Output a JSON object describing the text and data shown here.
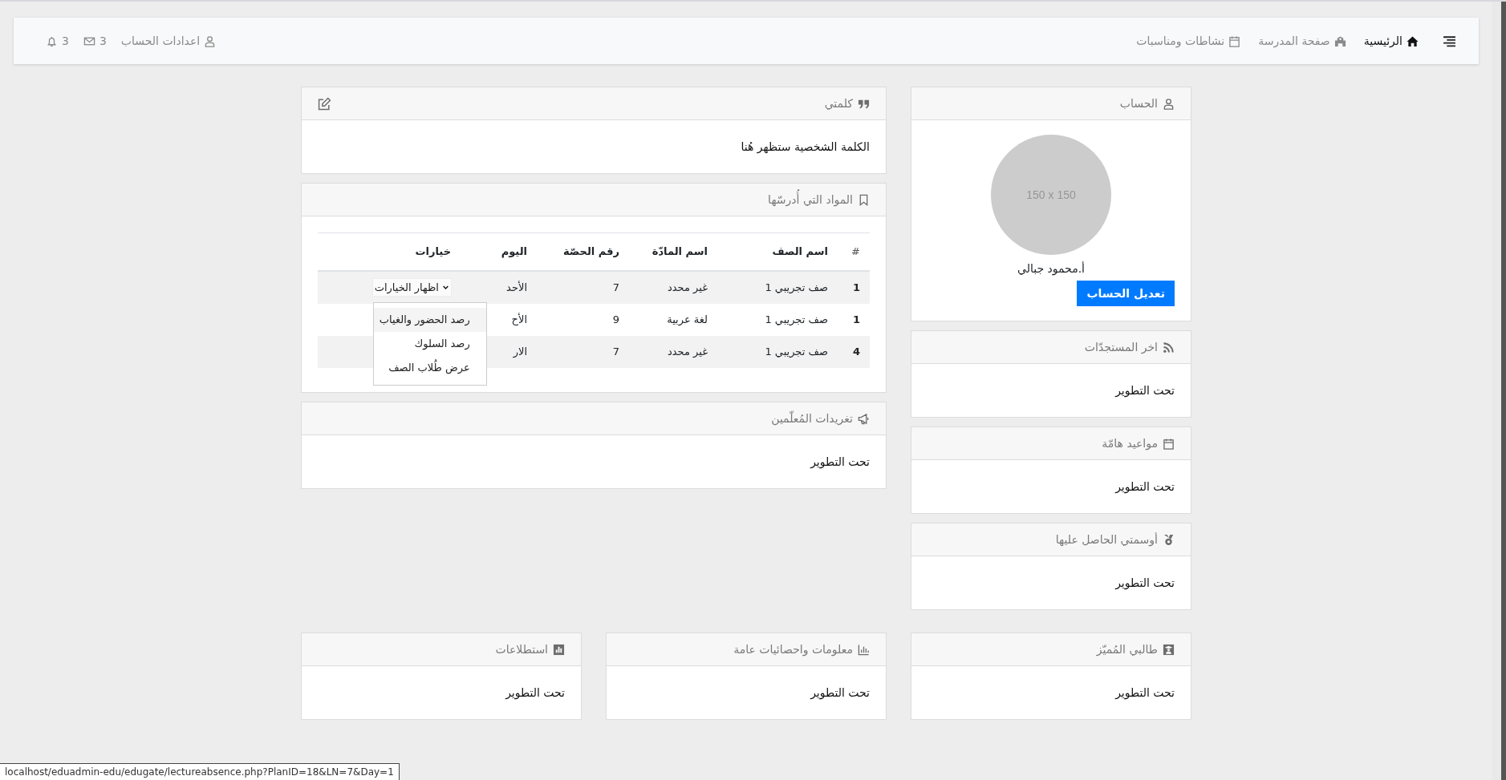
{
  "navbar": {
    "items": [
      {
        "label": "الرئيسية",
        "kind": "home",
        "selected": true
      },
      {
        "label": "صفحة المدرسة",
        "kind": "school",
        "selected": false
      },
      {
        "label": "نشاطات ومناسبات",
        "kind": "calendar",
        "selected": false
      }
    ],
    "notifications": "3",
    "messages": "3",
    "account": "اعدادات الحساب"
  },
  "account_card": {
    "title": "الحساب",
    "avatar_label": "150 x 150",
    "name": "أ.محمود جبالي",
    "edit_button": "تعديل الحساب"
  },
  "side_panels": [
    {
      "kind": "rss",
      "title": "اخر المستجدّات",
      "text": "تحت التطوير"
    },
    {
      "kind": "calendar",
      "title": "مواعيد هامّة",
      "text": "تحت التطوير"
    },
    {
      "kind": "medal",
      "title": "أوسمتي الحاصل عليها",
      "text": "تحت التطوير"
    }
  ],
  "my_word": {
    "title": "كلمتي",
    "text": "الكلمة الشخصية ستظهر هُنا"
  },
  "subjects": {
    "title": "المواد التي أُدرسّها",
    "columns": [
      "#",
      "اسم الصف",
      "اسم المادّة",
      "رقم الحصّة",
      "اليوم",
      "خيارات"
    ],
    "rows": [
      {
        "cells": [
          "1",
          "صف تجريبي 1",
          "غير محدد",
          "7",
          "الأحد"
        ],
        "options": "اظهار الخيارات",
        "expanded": true
      },
      {
        "cells": [
          "1",
          "صف تجريبي 1",
          "لغة عربية",
          "9",
          "الأح"
        ]
      },
      {
        "cells": [
          "4",
          "صف تجريبي 1",
          "غير محدد",
          "7",
          "الار"
        ]
      }
    ],
    "menu": [
      {
        "label": "رصد الحضور والغياب",
        "selected": true
      },
      {
        "label": "رصد السلوك",
        "selected": false
      },
      {
        "label": "عرض طُلاب الصف",
        "selected": false
      }
    ]
  },
  "tweets": {
    "title": "تغريدات المُعلّمين",
    "text": "تحت التطوير"
  },
  "bottom_panels": [
    {
      "kind": "graduate",
      "title": "طالبي المُميّز",
      "text": "تحت التطوير"
    },
    {
      "kind": "bars",
      "title": "معلومات واحصائيات عامة",
      "text": "تحت التطوير"
    },
    {
      "kind": "chart",
      "title": "استطلاعات",
      "text": "تحت التطوير"
    }
  ],
  "status_url": "localhost/eduadmin-edu/edugate/lectureabsence.php?PlanID=18&LN=7&Day=1"
}
